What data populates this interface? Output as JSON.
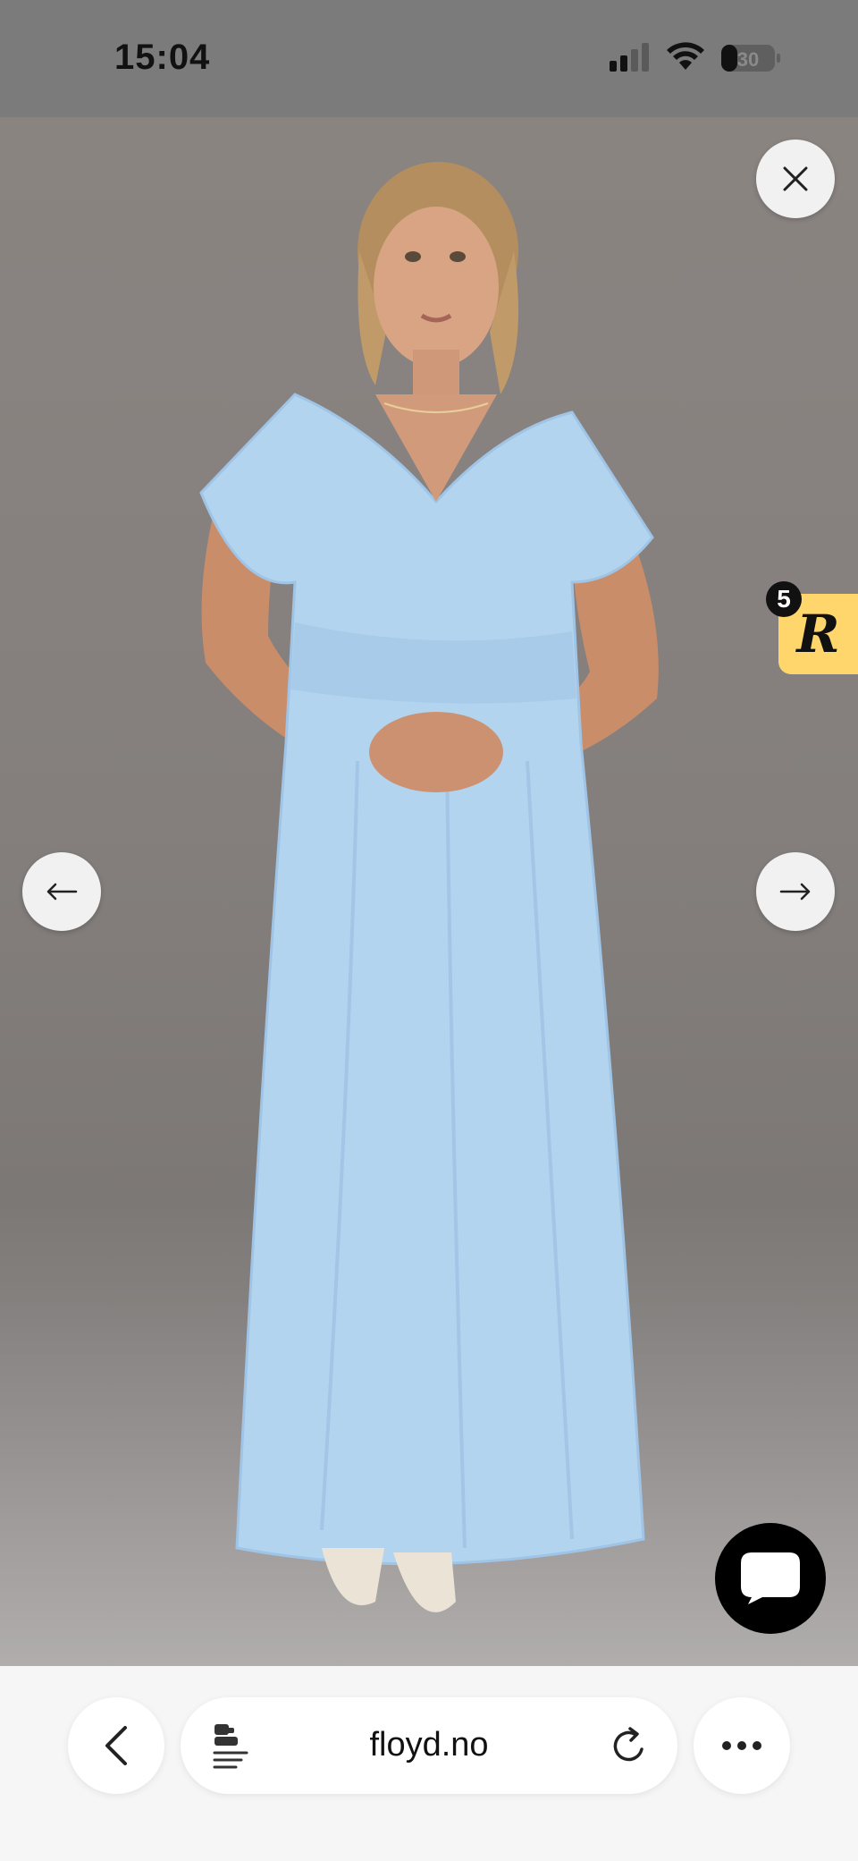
{
  "status_bar": {
    "time": "15:04",
    "battery_level": "30"
  },
  "viewer": {
    "close_icon": "close-icon",
    "prev_icon": "arrow-left-icon",
    "next_icon": "arrow-right-icon"
  },
  "reviews_widget": {
    "count": "5",
    "letter": "R",
    "color": "#ffd66b"
  },
  "chat": {
    "icon": "chat-bubble-icon"
  },
  "browser": {
    "url": "floyd.no",
    "back_icon": "chevron-left-icon",
    "reader_icon": "reader-mode-icon",
    "reload_icon": "reload-icon",
    "more_icon": "more-icon"
  }
}
